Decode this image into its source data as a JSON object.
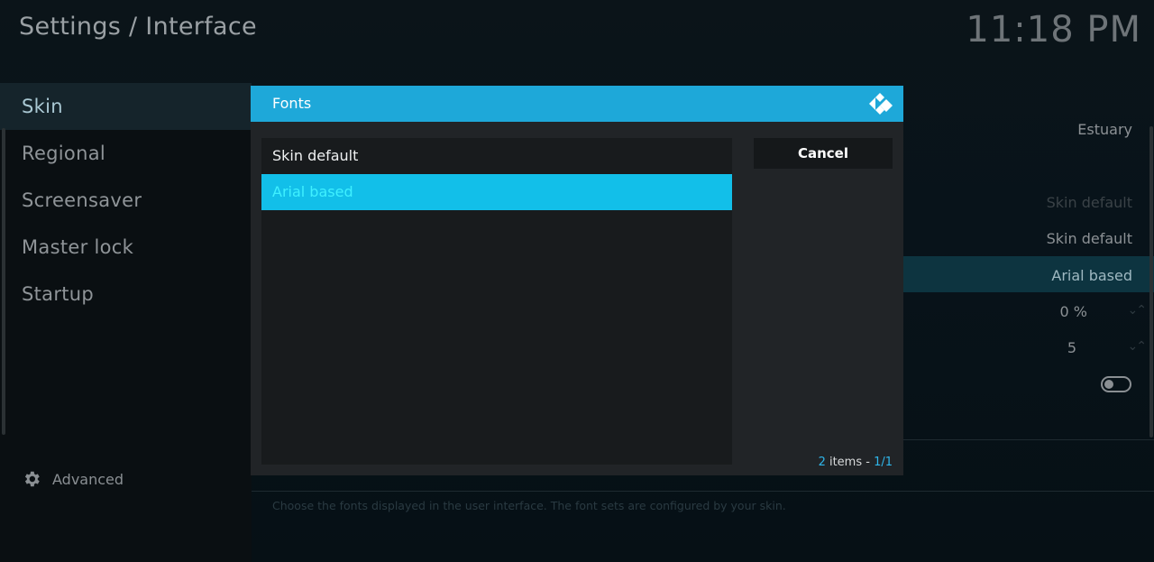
{
  "header": {
    "title": "Settings / Interface",
    "clock": "11:18 PM"
  },
  "sidebar": {
    "items": [
      {
        "label": "Skin"
      },
      {
        "label": "Regional"
      },
      {
        "label": "Screensaver"
      },
      {
        "label": "Master lock"
      },
      {
        "label": "Startup"
      }
    ],
    "advanced_label": "Advanced"
  },
  "background_settings": {
    "skin_value": "Estuary",
    "dim_value": "Skin default",
    "font_size_value": "Skin default",
    "fonts_value": "Arial based",
    "zoom_value": "0 %",
    "stereo_value": "5",
    "description": "Choose the fonts displayed in the user interface. The font sets are configured by your skin."
  },
  "dialog": {
    "title": "Fonts",
    "options": [
      {
        "label": "Skin default"
      },
      {
        "label": "Arial based"
      }
    ],
    "cancel_label": "Cancel",
    "count": {
      "items_number": "2",
      "items_label": " items - ",
      "page": "1/1"
    }
  },
  "colors": {
    "accent": "#1ea8d9",
    "selected_item": "#12bfe9",
    "selected_text": "#3ff0ff"
  },
  "icons": [
    "gear-icon",
    "kodi-logo-icon",
    "spinner-arrows-icon",
    "toggle-switch"
  ]
}
